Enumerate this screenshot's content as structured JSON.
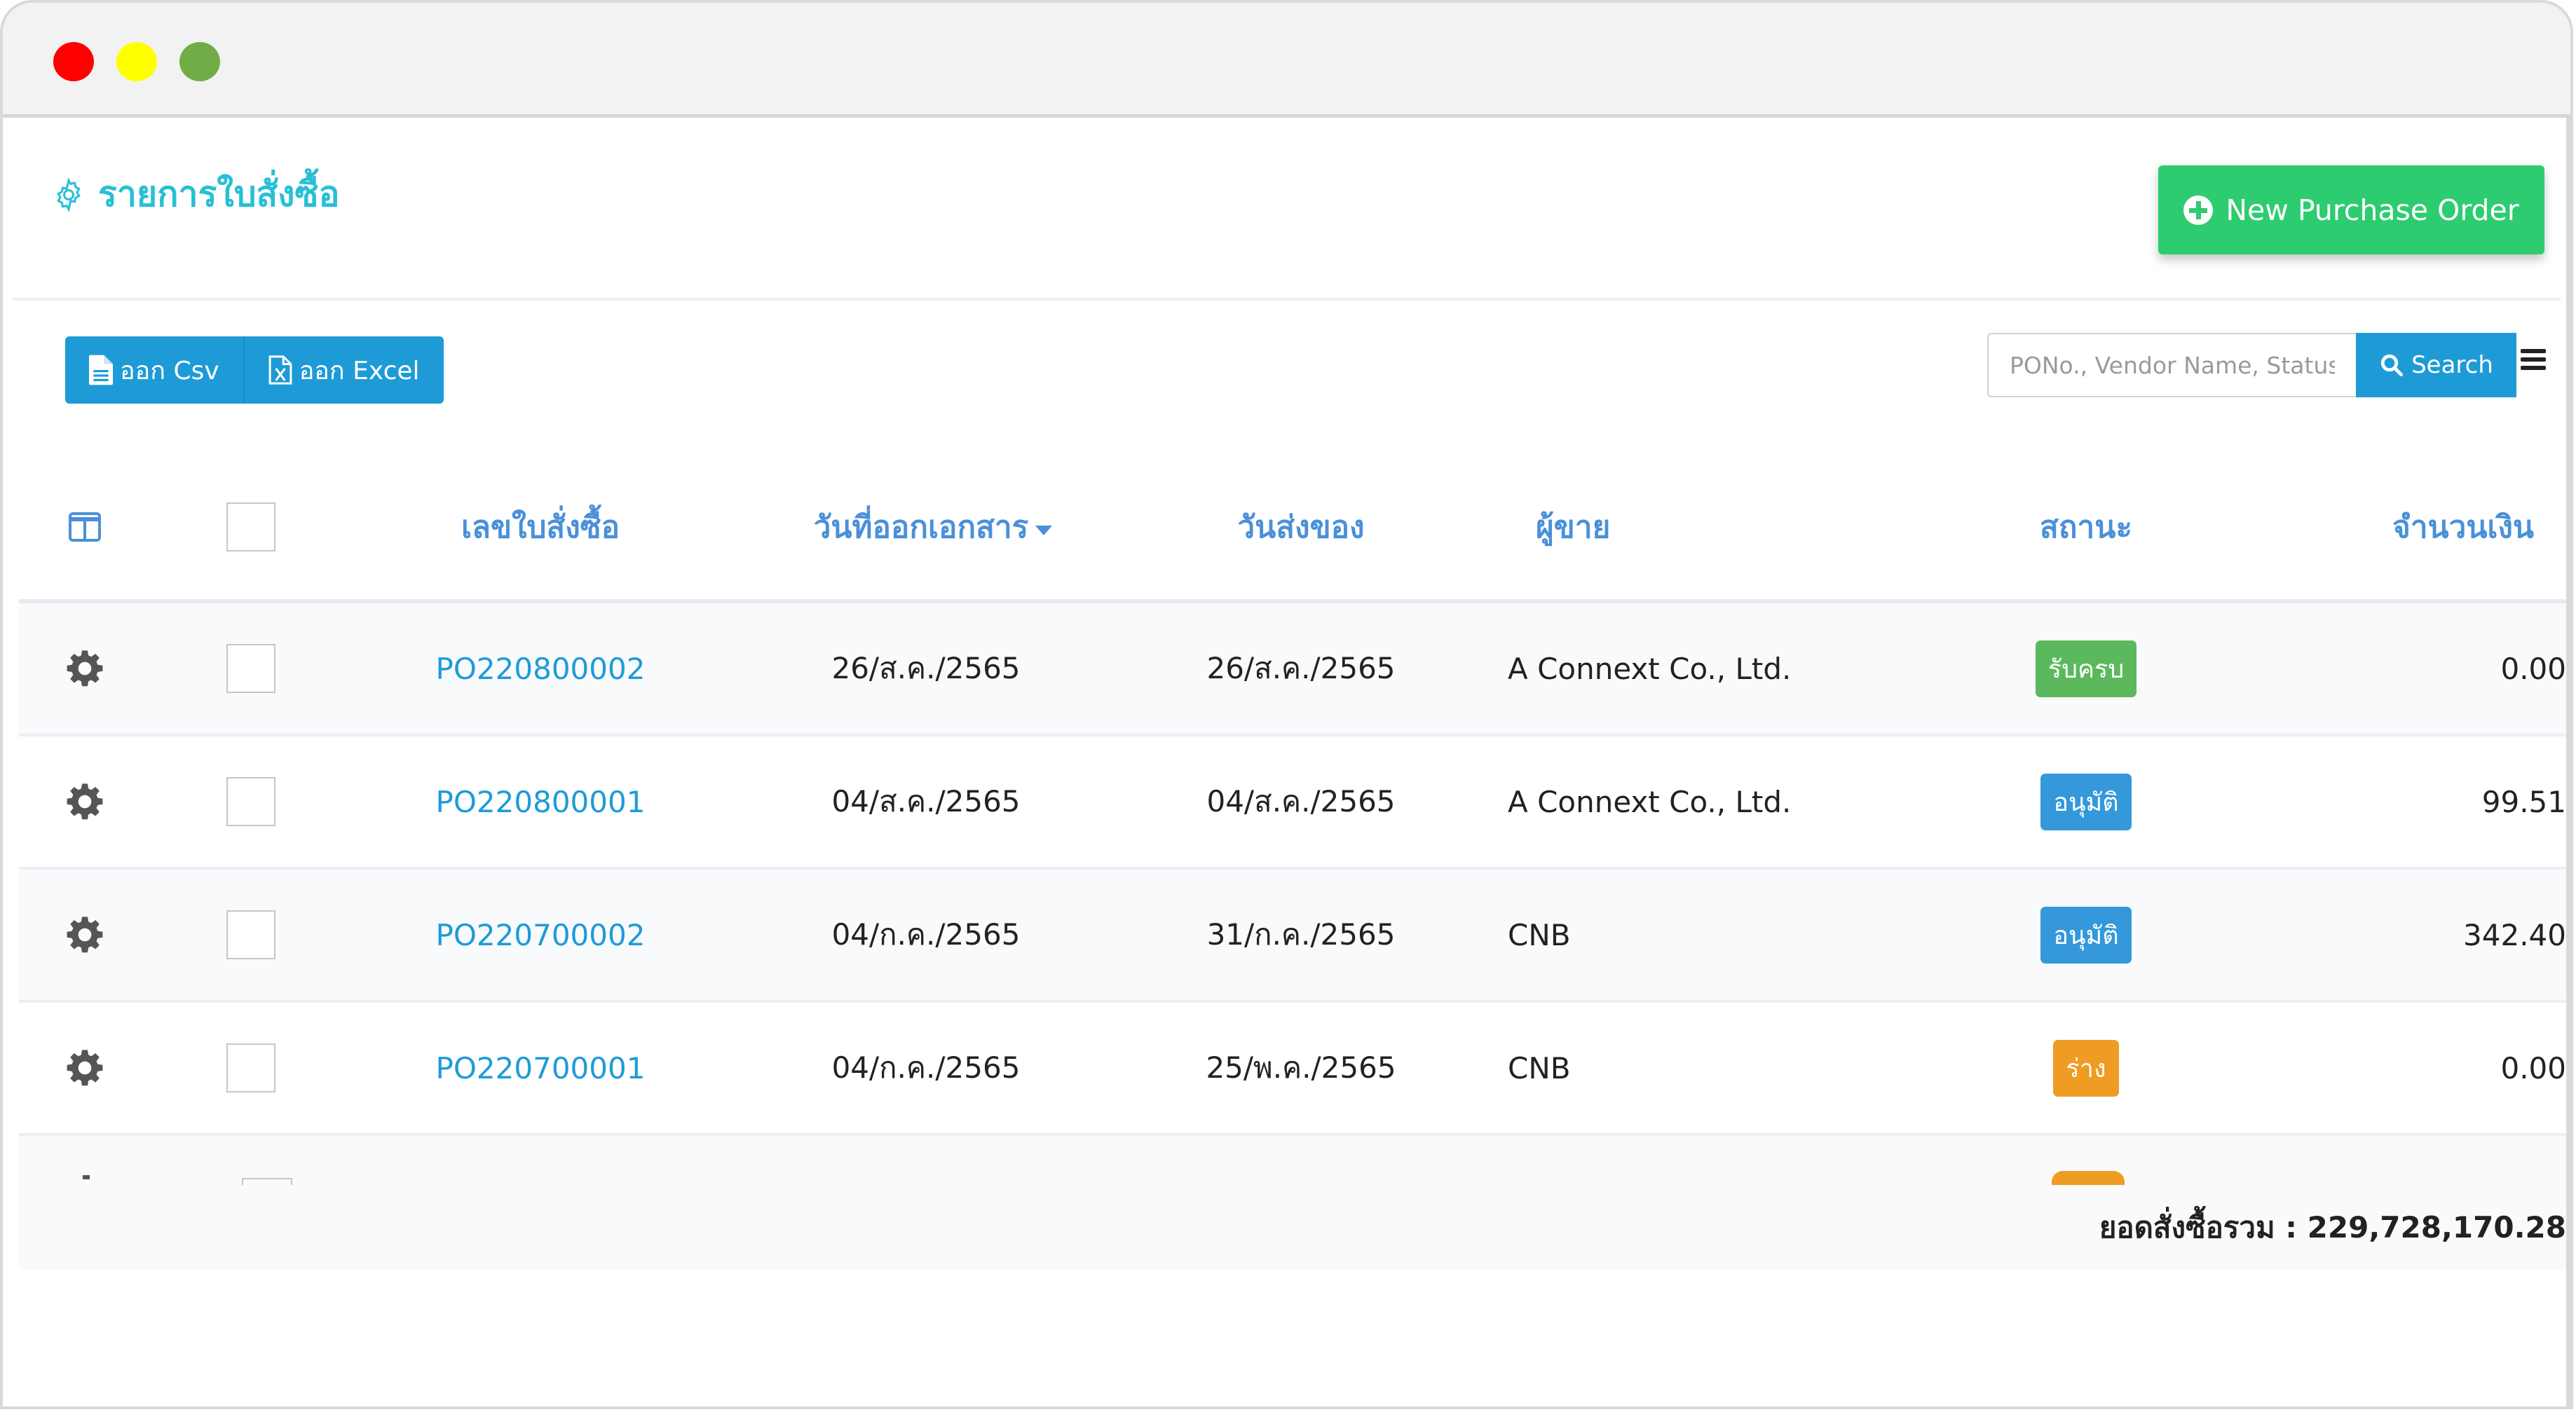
{
  "window": {
    "controls": [
      "close",
      "minimize",
      "maximize"
    ]
  },
  "header": {
    "title": "รายการใบสั่งซื้อ",
    "title_icon": "gear-outline-icon",
    "new_button_label": "New Purchase Order",
    "new_button_icon": "plus-circle-icon"
  },
  "toolbar": {
    "export_csv_label": "ออก Csv",
    "export_excel_label": "ออก Excel",
    "search_placeholder": "PONo., Vendor Name, Status",
    "search_value": "",
    "search_button_label": "Search",
    "menu_icon": "hamburger-icon"
  },
  "table": {
    "columns": {
      "po_number": "เลขใบสั่งซื้อ",
      "doc_date": "วันที่ออกเอกสาร",
      "delivery_date": "วันส่งของ",
      "vendor": "ผู้ขาย",
      "status": "สถานะ",
      "amount": "จำนวนเงิน"
    },
    "sort": {
      "column": "doc_date",
      "direction": "desc"
    },
    "rows": [
      {
        "po_number": "PO220800002",
        "doc_date": "26/ส.ค./2565",
        "delivery_date": "26/ส.ค./2565",
        "vendor": "A Connext Co., Ltd.",
        "status": "รับครบ",
        "status_color": "#5cb85c",
        "amount": "0.00",
        "checked": false
      },
      {
        "po_number": "PO220800001",
        "doc_date": "04/ส.ค./2565",
        "delivery_date": "04/ส.ค./2565",
        "vendor": "A Connext Co., Ltd.",
        "status": "อนุมัติ",
        "status_color": "#3498db",
        "amount": "99.51",
        "checked": false
      },
      {
        "po_number": "PO220700002",
        "doc_date": "04/ก.ค./2565",
        "delivery_date": "31/ก.ค./2565",
        "vendor": "CNB",
        "status": "อนุมัติ",
        "status_color": "#3498db",
        "amount": "342.40",
        "checked": false
      },
      {
        "po_number": "PO220700001",
        "doc_date": "04/ก.ค./2565",
        "delivery_date": "25/พ.ค./2565",
        "vendor": "CNB",
        "status": "ร่าง",
        "status_color": "#ee9c23",
        "amount": "0.00",
        "checked": false
      }
    ],
    "total_label": "ยอดสั่งซื้อรวม : 229,728,170.28"
  },
  "colors": {
    "title": "#28bfd6",
    "primary": "#1e9bd7",
    "success": "#2ecc71",
    "header_text": "#4a90d9"
  }
}
